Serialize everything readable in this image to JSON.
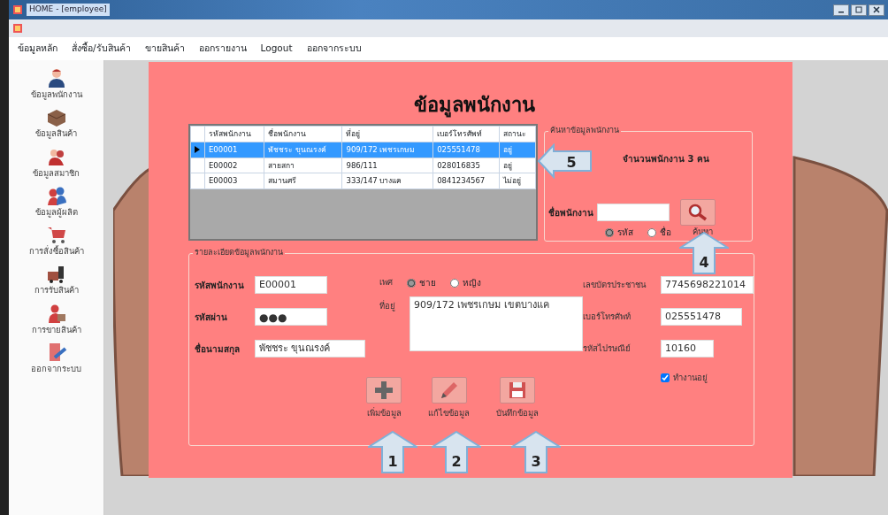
{
  "window": {
    "title": "HOME - [employee]"
  },
  "menu": [
    {
      "label": "ข้อมูลหลัก"
    },
    {
      "label": "สั่งซื้อ/รับสินค้า"
    },
    {
      "label": "ขายสินค้า"
    },
    {
      "label": "ออกรายงาน"
    },
    {
      "label": "Logout"
    },
    {
      "label": "ออกจากระบบ"
    }
  ],
  "sidebar": [
    {
      "label": "ข้อมูลพนักงาน"
    },
    {
      "label": "ข้อมูลสินค้า"
    },
    {
      "label": "ข้อมูลสมาชิก"
    },
    {
      "label": "ข้อมูลผู้ผลิต"
    },
    {
      "label": "การสั่งซื้อสินค้า"
    },
    {
      "label": "การรับสินค้า"
    },
    {
      "label": "การขายสินค้า"
    },
    {
      "label": "ออกจากระบบ"
    }
  ],
  "form": {
    "title": "ข้อมูลพนักงาน",
    "grid": {
      "columns": [
        "รหัสพนักงาน",
        "ชื่อพนักงาน",
        "ที่อยู่",
        "เบอร์โทรศัพท์",
        "สถานะ"
      ],
      "rows": [
        {
          "selected": true,
          "cells": [
            "E00001",
            "พัชชระ ขุนณรงค์",
            "909/172 เพชรเกษม",
            "025551478",
            "อยู่"
          ]
        },
        {
          "selected": false,
          "cells": [
            "E00002",
            "สายสกา",
            "986/111",
            "028016835",
            "อยู่"
          ]
        },
        {
          "selected": false,
          "cells": [
            "E00003",
            "สมานศรี",
            "333/147 บางแค",
            "0841234567",
            "ไม่อยู่"
          ]
        }
      ]
    },
    "search": {
      "legend": "ค้นหาข้อมูลพนักงาน",
      "count": "จำนวนพนักงาน 3 คน",
      "label": "ชื่อพนักงาน",
      "options": [
        {
          "label": "รหัส",
          "selected": true
        },
        {
          "label": "ชื่อ",
          "selected": false
        }
      ],
      "button_caption": "ค้นหา"
    },
    "details": {
      "legend": "รายละเอียดข้อมูลพนักงาน",
      "left": [
        {
          "kind": "text",
          "label": "รหัสพนักงาน",
          "value": "E00001"
        },
        {
          "kind": "password",
          "label": "รหัสผ่าน",
          "value": "●●●"
        },
        {
          "kind": "text",
          "label": "ชื่อนามสกุล",
          "value": "พัชชระ ขุนณรงค์"
        }
      ],
      "gender": {
        "label": "เพศ",
        "options": [
          {
            "label": "ชาย",
            "selected": true
          },
          {
            "label": "หญิง",
            "selected": false
          }
        ]
      },
      "address": {
        "label": "ที่อยู่",
        "value": "909/172 เพชรเกษม เขตบางแค"
      },
      "right": [
        {
          "label": "เลขบัตรประชาชน",
          "value": "7745698221014"
        },
        {
          "label": "เบอร์โทรศัพท์",
          "value": "025551478"
        },
        {
          "label": "รหัสไปรษณีย์",
          "value": "10160"
        }
      ],
      "active": {
        "label": "ทำงานอยู่",
        "checked": true
      },
      "buttons": [
        {
          "caption": "เพิ่มข้อมูล"
        },
        {
          "caption": "แก้ไขข้อมูล"
        },
        {
          "caption": "บันทึกข้อมูล"
        }
      ]
    },
    "callouts": [
      {
        "number": "5"
      },
      {
        "number": "4"
      },
      {
        "number": "1"
      },
      {
        "number": "2"
      },
      {
        "number": "3"
      }
    ]
  }
}
